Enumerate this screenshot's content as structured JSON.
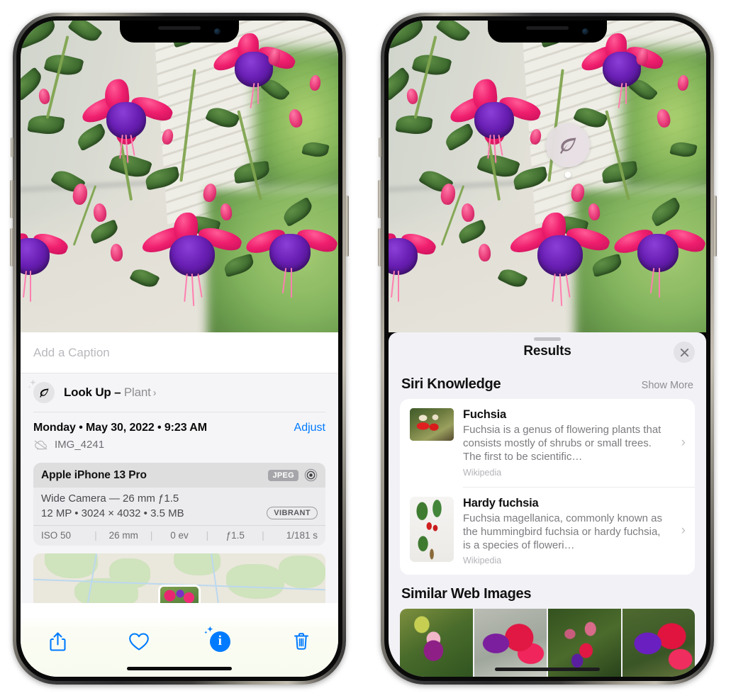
{
  "left_phone": {
    "caption_placeholder": "Add a Caption",
    "lookup": {
      "label": "Look Up – ",
      "subject": "Plant",
      "chevron": "›",
      "icon": "leaf-icon"
    },
    "date": "Monday • May 30, 2022 • 9:23 AM",
    "adjust_label": "Adjust",
    "filename": "IMG_4241",
    "metadata": {
      "device": "Apple iPhone 13 Pro",
      "format_badge": "JPEG",
      "lens_line": "Wide Camera — 26 mm ƒ1.5",
      "size_line": "12 MP • 3024 × 4032 • 3.5 MB",
      "style_badge": "VIBRANT",
      "exif": [
        "ISO 50",
        "26 mm",
        "0 ev",
        "ƒ1.5",
        "1/181 s"
      ],
      "separator": "|"
    },
    "toolbar": {
      "share_label": "share-icon",
      "favorite_label": "heart-icon",
      "info_label": "info-icon",
      "info_glyph": "i",
      "delete_label": "trash-icon"
    }
  },
  "right_phone": {
    "pin_icon": "leaf-icon",
    "sheet_title": "Results",
    "close_label": "close-icon",
    "siri_section": {
      "title": "Siri Knowledge",
      "show_more": "Show More",
      "items": [
        {
          "title": "Fuchsia",
          "description": "Fuchsia is a genus of flowering plants that consists mostly of shrubs or small trees. The first to be scientific…",
          "source": "Wikipedia",
          "chevron": "›"
        },
        {
          "title": "Hardy fuchsia",
          "description": "Fuchsia magellanica, commonly known as the hummingbird fuchsia or hardy fuchsia, is a species of floweri…",
          "source": "Wikipedia",
          "chevron": "›"
        }
      ]
    },
    "web_section": {
      "title": "Similar Web Images",
      "thumbnails": [
        "fuchsia-thumb-1",
        "fuchsia-thumb-2",
        "fuchsia-thumb-3",
        "fuchsia-thumb-4"
      ]
    }
  },
  "colors": {
    "accent_blue": "#007AFF",
    "sheet_gray": "#f2f1f6",
    "text_primary": "#111111",
    "text_secondary": "#8e8e93"
  }
}
